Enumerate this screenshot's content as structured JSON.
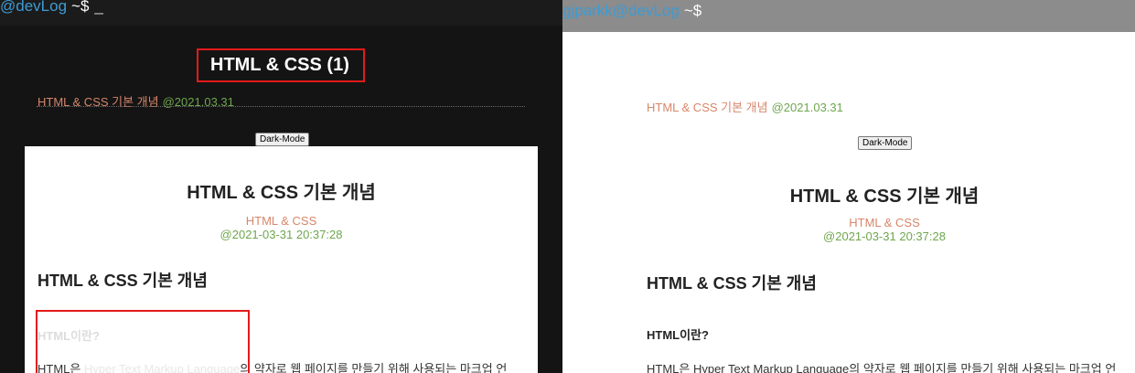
{
  "left": {
    "prompt": {
      "host": "@devLog",
      "tilde": "~$",
      "cursor": "_"
    },
    "blog_title": "HTML & CSS (1)",
    "post_item": {
      "category": "HTML & CSS 기본 개념",
      "date": "@2021.03.31"
    },
    "mode_button": "Dark-Mode",
    "article": {
      "title": "HTML & CSS 기본 개념",
      "category": "HTML & CSS",
      "timestamp": "@2021-03-31 20:37:28",
      "section_heading": "HTML & CSS 기본 개념",
      "sub_heading": "HTML이란?",
      "paragraph_start": "HTML은 ",
      "paragraph_faded": "Hyper Text Markup Language",
      "paragraph_rest": "의 약자로 웹 페이지를 만들기 위해 사용되는 마크업 언"
    }
  },
  "right": {
    "prompt": {
      "host": "gjparkk@devLog",
      "tilde": "~$"
    },
    "post_item": {
      "category": "HTML & CSS 기본 개념",
      "date": "@2021.03.31"
    },
    "mode_button": "Dark-Mode",
    "article": {
      "title": "HTML & CSS 기본 개념",
      "category": "HTML & CSS",
      "timestamp": "@2021-03-31 20:37:28",
      "section_heading": "HTML & CSS 기본 개념",
      "sub_heading": "HTML이란?",
      "paragraph": "HTML은 Hyper Text Markup Language의 약자로 웹 페이지를 만들기 위해 사용되는 마크업 언"
    }
  },
  "colors": {
    "accent_red": "#e31a1a",
    "category": "#d7866a",
    "date": "#6ea64e",
    "prompt_host": "#3d9bd4"
  }
}
